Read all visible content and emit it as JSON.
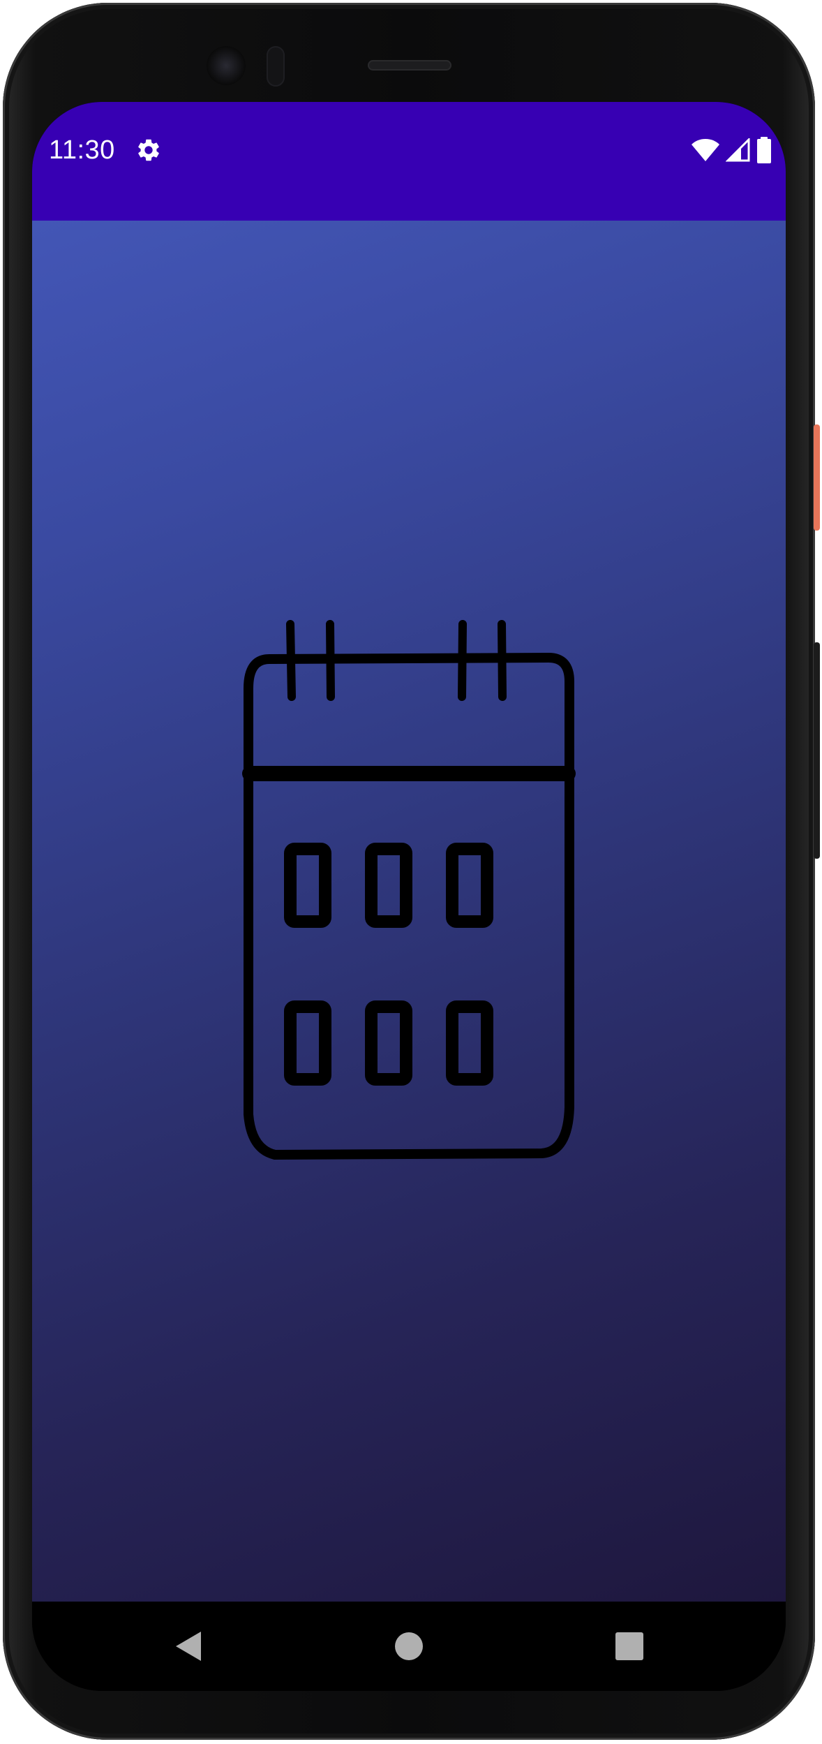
{
  "status_bar": {
    "time": "11:30",
    "settings_icon": "gear-icon",
    "wifi_icon": "wifi-icon",
    "signal_icon": "cell-signal-icon",
    "battery_icon": "battery-icon",
    "background_color": "#3700b3"
  },
  "content": {
    "illustration": "calendar-icon",
    "gradient_colors": [
      "#4356b6",
      "#1e173d"
    ]
  },
  "nav_bar": {
    "back_icon": "back-triangle-icon",
    "home_icon": "home-circle-icon",
    "recents_icon": "recents-square-icon"
  },
  "colors": {
    "accent": "#3700b3",
    "calendar_stroke": "#000000",
    "nav_icon": "#b0b0b0",
    "power_button": "#e8765a"
  }
}
